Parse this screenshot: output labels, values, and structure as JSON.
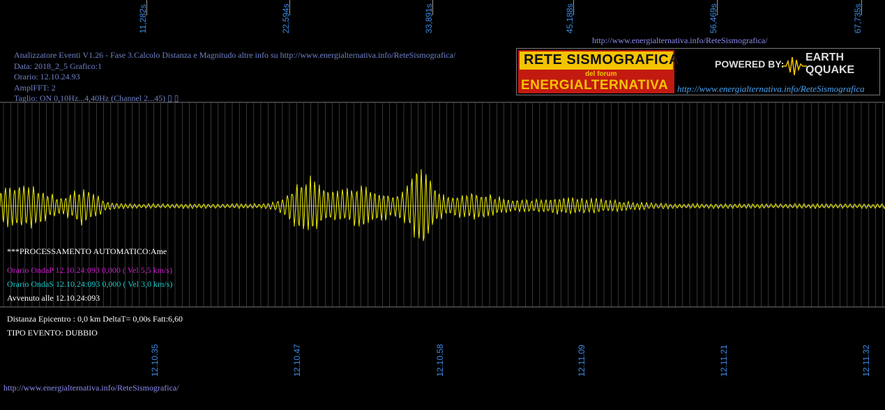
{
  "top_time_labels": [
    "11,282s",
    "22,594s",
    "33,891s",
    "45,188s",
    "56,469s",
    "67,735s"
  ],
  "top_url": "http://www.energialternativa.info/ReteSismografica/",
  "info": {
    "line1": "Analizzatore Eventi V1.26 - Fase 3.Calcolo Distanza e Magnitudo altre info su http://www.energialternativa.info/ReteSismografica/",
    "line2": "Data: 2018_2_5 Grafico:1",
    "line3": "Orario: 12.10.24.93",
    "line4": "AmplFFT: 2",
    "line5": "Taglio: ON 0,10Hz...4,40Hz       (Channel 2...45) ▯ ▯"
  },
  "logo": {
    "title_top": "RETE SISMOGRAFICA",
    "subtitle": "del forum",
    "title_bottom": "ENERGIALTERNATIVA",
    "powered_by": "POWERED BY:",
    "brand_line1": "EARTH",
    "brand_line2": "QQUAKE",
    "url": "http://www.energialternativa.info/ReteSismografica"
  },
  "processing": {
    "header": "***PROCESSAMENTO AUTOMATICO:Ame",
    "onda_p": "Orario OndaP 12.10.24:093  0,000 ( Vel 5,5 km/s)",
    "onda_s": "Orario OndaS 12.10.24:093  0,000 ( Vel 3,0 km/s)",
    "avvenuto": "Avvenuto alle 12.10.24:093"
  },
  "results": {
    "distanza": "Distanza Epicentro : 0,0 km DeltaT= 0,00s  Fatt:6,60",
    "tipo": "TIPO EVENTO: DUBBIO"
  },
  "bottom_time_labels": [
    "12.10.35",
    "12.10.47",
    "12.10.58",
    "12.11.09",
    "12.11.21",
    "12.11.32"
  ],
  "bottom_url": "http://www.energialternativa.info/ReteSismografica/",
  "colors": {
    "trace": "#f2f200",
    "onda_p": "#d11bd1",
    "onda_s": "#17c9c9",
    "grid": "#5a5a5a",
    "label_blue": "#3b8be6"
  }
}
